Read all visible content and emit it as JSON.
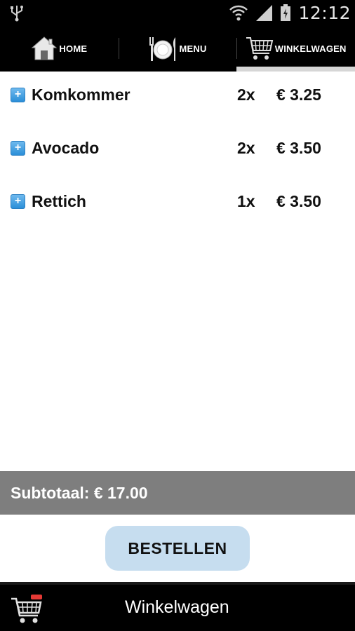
{
  "status_bar": {
    "time": "12:12",
    "icons": [
      "usb-icon",
      "wifi-icon",
      "signal-icon",
      "battery-icon"
    ]
  },
  "tabs": [
    {
      "label": "HOME",
      "icon": "home-icon",
      "active": false
    },
    {
      "label": "MENU",
      "icon": "plate-cutlery-icon",
      "active": false
    },
    {
      "label": "WINKELWAGEN",
      "icon": "shopping-cart-icon",
      "active": true
    }
  ],
  "cart": {
    "items": [
      {
        "name": "Komkommer",
        "quantity": "2x",
        "price": "€ 3.25"
      },
      {
        "name": "Avocado",
        "quantity": "2x",
        "price": "€ 3.50"
      },
      {
        "name": "Rettich",
        "quantity": "1x",
        "price": "€ 3.50"
      }
    ]
  },
  "subtotal": "Subtotaal: € 17.00",
  "order_button_label": "BESTELLEN",
  "bottom_bar": {
    "title": "Winkelwagen",
    "icon": "shopping-cart-icon"
  },
  "colors": {
    "plus_button": "#3a9ae0",
    "subtotal_bar": "#7e7e7e",
    "order_button": "#c6ddef",
    "bars": "#000000"
  }
}
